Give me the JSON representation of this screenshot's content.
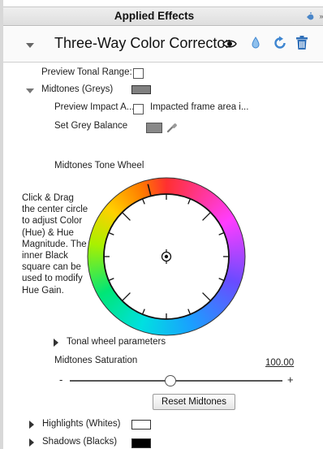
{
  "header": {
    "title": "Applied Effects"
  },
  "effect": {
    "title": "Three-Way Color Corrector",
    "icons": [
      "eye-icon",
      "drop-icon",
      "reset-icon",
      "trash-icon"
    ]
  },
  "preview_tonal_range": {
    "label": "Preview Tonal Range:",
    "checked": false
  },
  "midtones": {
    "label": "Midtones (Greys)",
    "swatch_color": "#808080",
    "preview_impact_label": "Preview Impact A...",
    "impacted_label": "Impacted frame area i...",
    "set_grey_label": "Set Grey Balance",
    "tone_wheel_label": "Midtones Tone Wheel",
    "help_text": "Click & Drag the center circle to adjust Color (Hue) & Hue Magnitude. The inner Black square can be used to modify Hue Gain.",
    "tonal_params_label": "Tonal wheel parameters",
    "saturation_label": "Midtones Saturation",
    "saturation_value": "100.00",
    "saturation_fraction": 0.5,
    "minus_label": "-",
    "plus_label": "+",
    "reset_label": "Reset Midtones"
  },
  "highlights": {
    "label": "Highlights (Whites)",
    "swatch_color": "#ffffff"
  },
  "shadows": {
    "label": "Shadows (Blacks)",
    "swatch_color": "#000000"
  },
  "colors": {
    "accent": "#3d85d0",
    "trash": "#2f6fb8"
  }
}
